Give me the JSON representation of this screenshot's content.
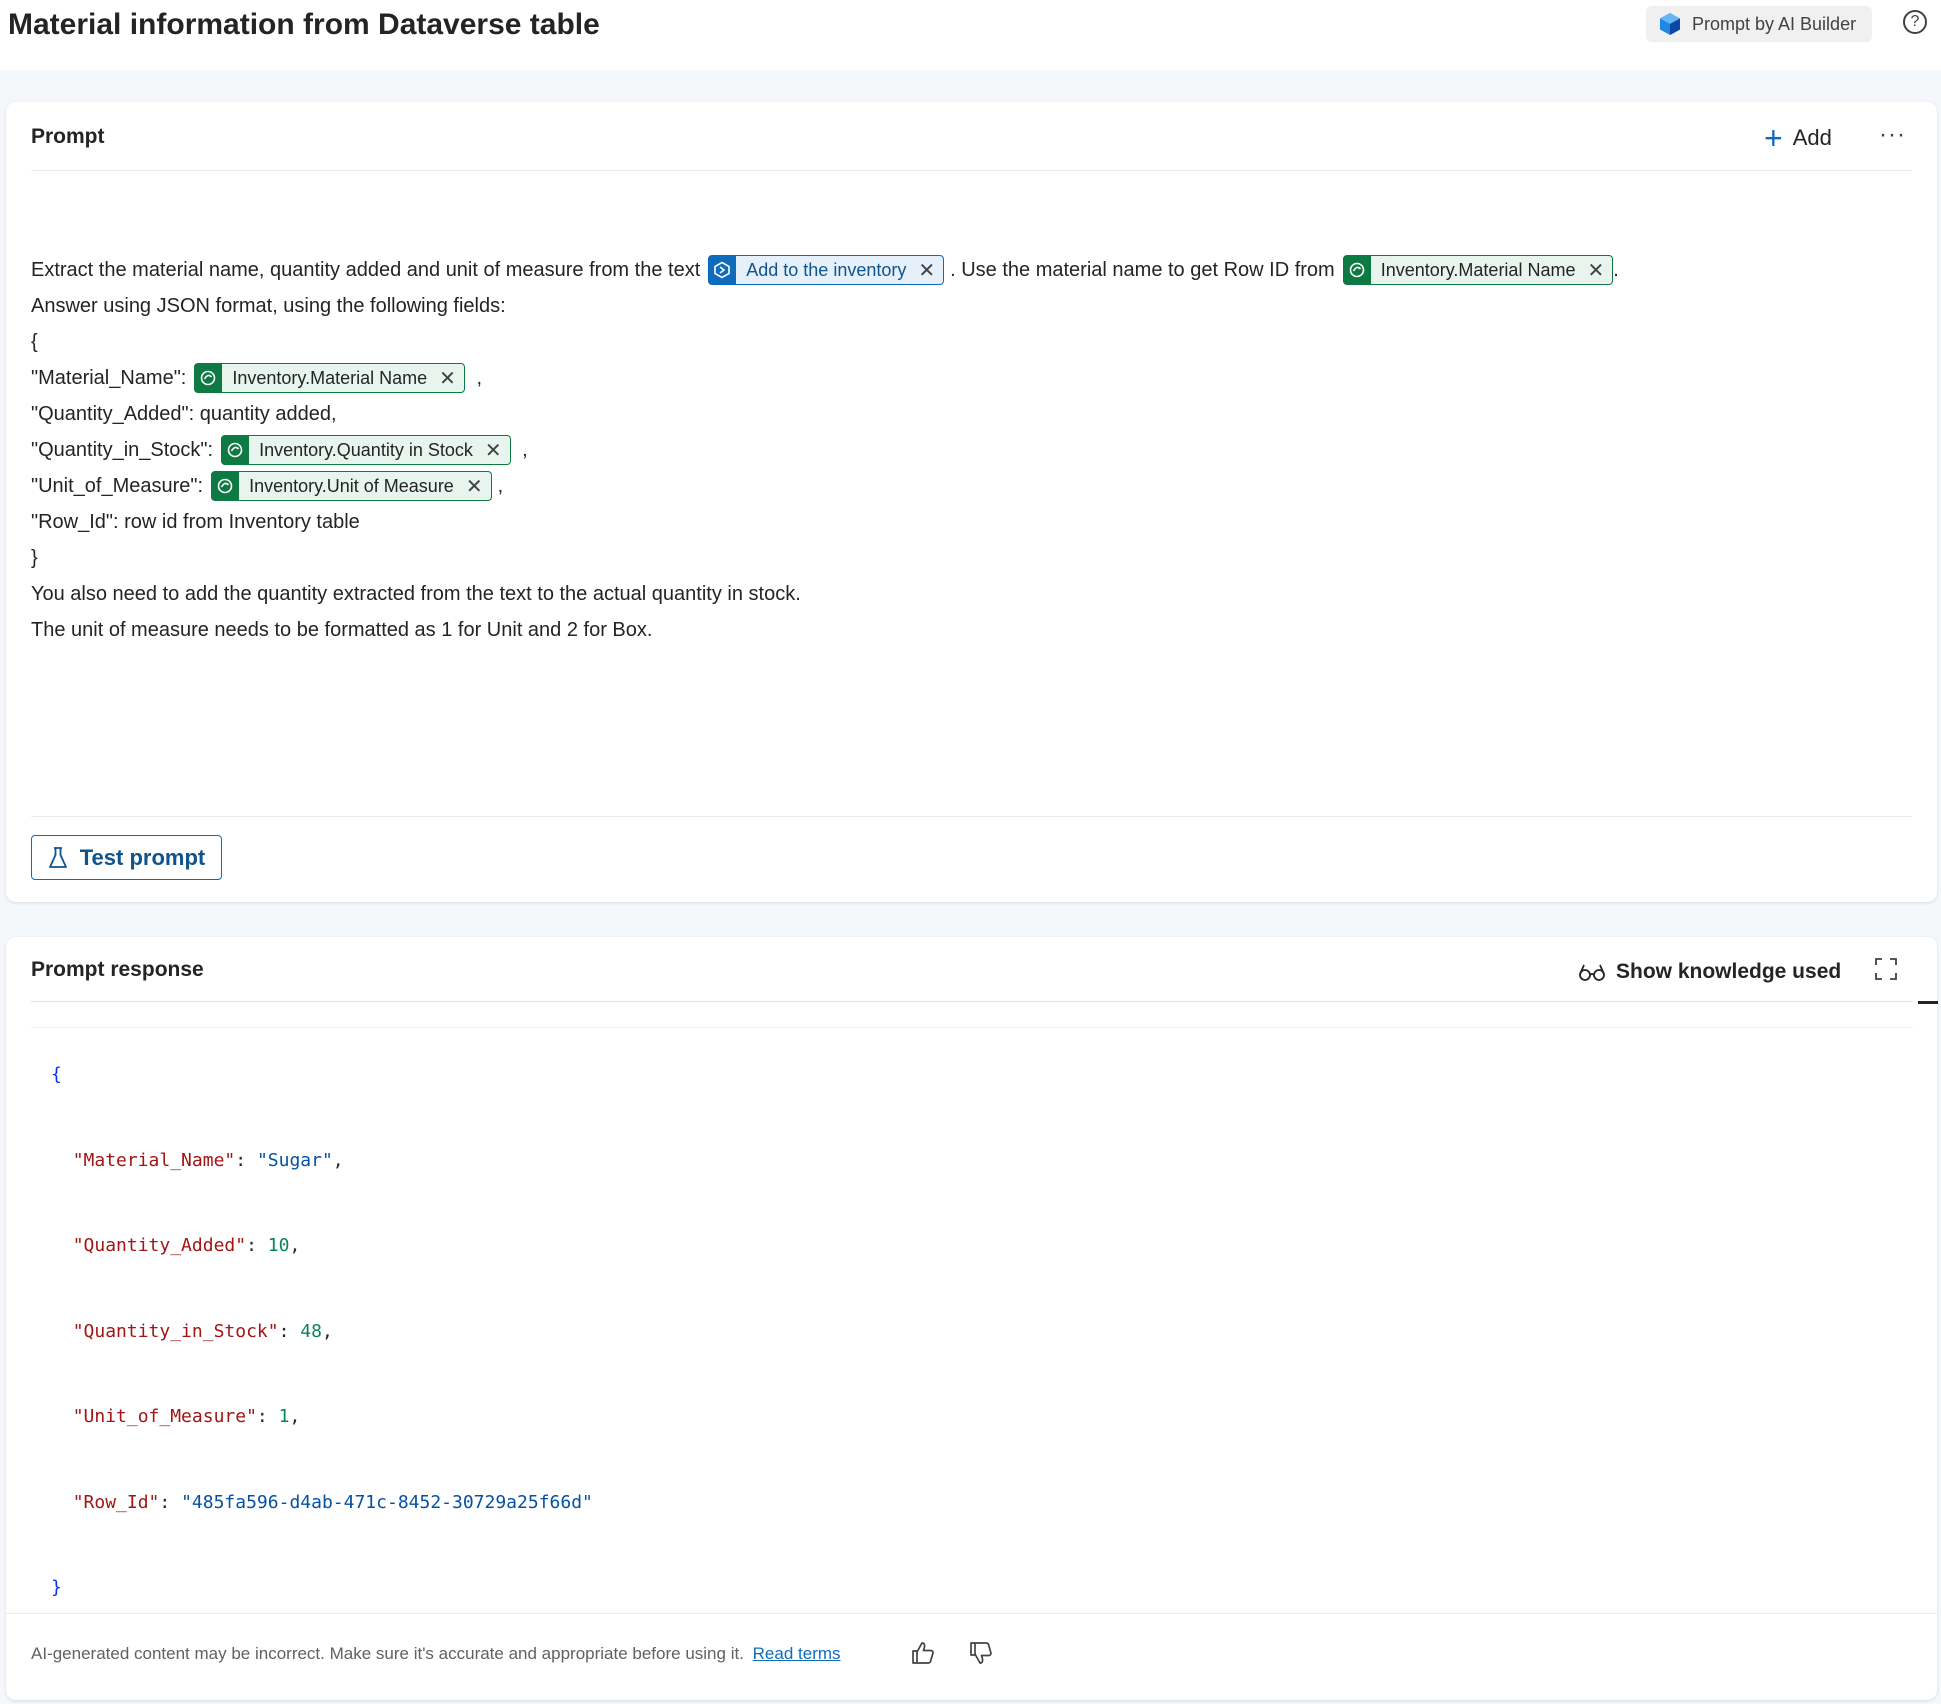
{
  "header": {
    "title": "Material information from Dataverse table",
    "badge_label": "Prompt by AI Builder",
    "help_glyph": "?"
  },
  "prompt": {
    "title": "Prompt",
    "add_label": "Add",
    "more_glyph": "···",
    "line1": {
      "before": "Extract the material name, quantity added and unit of measure from the text",
      "chip1": "Add to the inventory",
      "middle": ". Use the material name to get Row ID from",
      "chip2": "Inventory.Material Name",
      "after": "."
    },
    "line2": "Answer using JSON format, using the following fields:",
    "line3": "{",
    "line4": {
      "before": "\"Material_Name\":",
      "chip": "Inventory.Material Name",
      "after": " ,"
    },
    "line5": "\"Quantity_Added\": quantity added,",
    "line6": {
      "before": "\"Quantity_in_Stock\":",
      "chip": "Inventory.Quantity in Stock",
      "after": " ,"
    },
    "line7": {
      "before": "\"Unit_of_Measure\":",
      "chip": "Inventory.Unit of Measure",
      "after": ","
    },
    "line8": "\"Row_Id\": row id from Inventory table",
    "line9": "}",
    "line10": "You also need to add the quantity extracted from the text to the actual quantity in stock.",
    "line11": "The unit of measure needs to be formatted as 1 for Unit and 2 for Box.",
    "chip_close_glyph": "✕",
    "test_label": "Test prompt"
  },
  "response": {
    "title": "Prompt response",
    "knowledge_label": "Show knowledge used",
    "json": {
      "open": "{",
      "close": "}",
      "rows": [
        {
          "key": "\"Material_Name\"",
          "value": "\"Sugar\"",
          "kind": "str",
          "trail": ","
        },
        {
          "key": "\"Quantity_Added\"",
          "value": "10",
          "kind": "num",
          "trail": ","
        },
        {
          "key": "\"Quantity_in_Stock\"",
          "value": "48",
          "kind": "num",
          "trail": ","
        },
        {
          "key": "\"Unit_of_Measure\"",
          "value": "1",
          "kind": "num",
          "trail": ","
        },
        {
          "key": "\"Row_Id\"",
          "value": "\"485fa596-d4ab-471c-8452-30729a25f66d\"",
          "kind": "str",
          "trail": ""
        }
      ]
    },
    "disclaimer": "AI-generated content may be incorrect. Make sure it's accurate and appropriate before using it.",
    "read_terms": "Read terms"
  },
  "colors": {
    "accent": "#0f6cbd",
    "dataverse_green": "#0e7a43"
  },
  "icons": [
    "ai-builder-icon",
    "help-icon",
    "plus-icon",
    "more-icon",
    "dataverse-icon",
    "input-variable-icon",
    "close-icon",
    "beaker-icon",
    "glasses-icon",
    "expand-icon",
    "thumbs-up-icon",
    "thumbs-down-icon"
  ]
}
